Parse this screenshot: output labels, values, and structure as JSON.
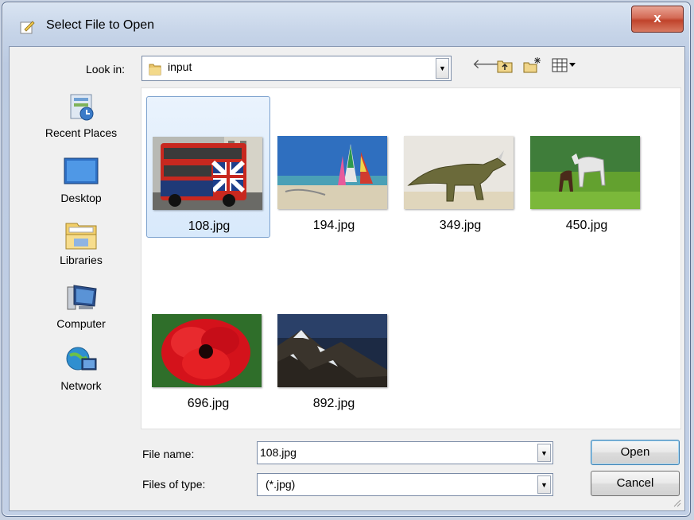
{
  "window": {
    "title": "Select File to Open",
    "close_glyph": "x"
  },
  "toolbar": {
    "look_in_label": "Look in:",
    "look_in_value": "input",
    "icons": [
      "back-arrow-icon",
      "up-folder-icon",
      "new-folder-icon",
      "view-menu-icon"
    ]
  },
  "places": [
    {
      "label": "Recent Places",
      "icon": "recent-places-icon"
    },
    {
      "label": "Desktop",
      "icon": "desktop-icon"
    },
    {
      "label": "Libraries",
      "icon": "libraries-icon"
    },
    {
      "label": "Computer",
      "icon": "computer-icon"
    },
    {
      "label": "Network",
      "icon": "network-icon"
    }
  ],
  "files": [
    {
      "name": "108.jpg",
      "selected": true,
      "image": "red double-decker bus"
    },
    {
      "name": "194.jpg",
      "selected": false,
      "image": "sailboats on beach"
    },
    {
      "name": "349.jpg",
      "selected": false,
      "image": "dinosaur"
    },
    {
      "name": "450.jpg",
      "selected": false,
      "image": "horses in field"
    },
    {
      "name": "696.jpg",
      "selected": false,
      "image": "red flower"
    },
    {
      "name": "892.jpg",
      "selected": false,
      "image": "snowy mountains"
    }
  ],
  "form": {
    "file_name_label": "File name:",
    "file_name_value": "108.jpg",
    "file_type_label": "Files of type:",
    "file_type_value": "(*.jpg)"
  },
  "buttons": {
    "open": "Open",
    "cancel": "Cancel"
  }
}
